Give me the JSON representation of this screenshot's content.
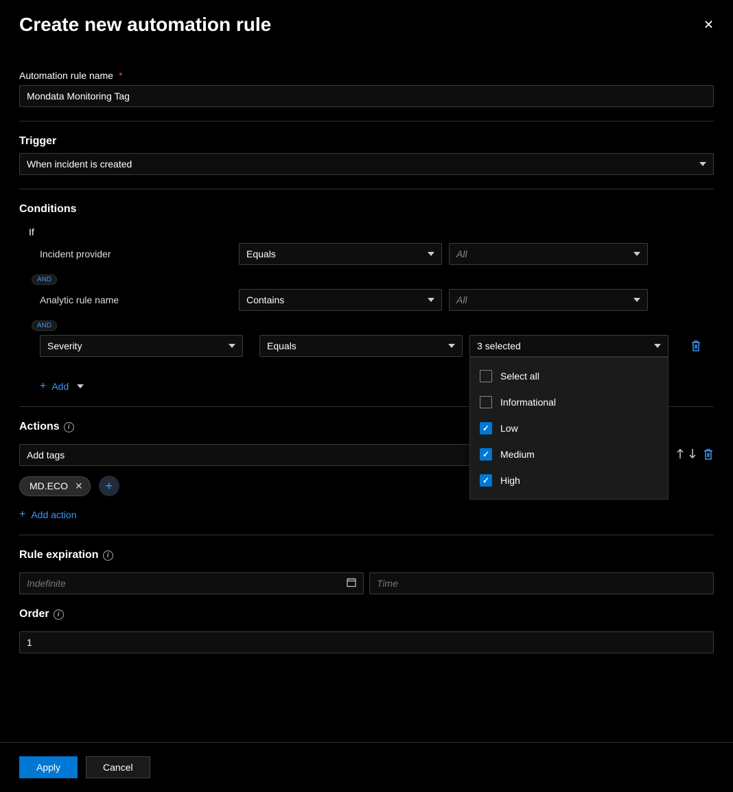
{
  "header": {
    "title": "Create new automation rule"
  },
  "ruleName": {
    "label": "Automation rule name",
    "value": "Mondata Monitoring Tag"
  },
  "trigger": {
    "label": "Trigger",
    "value": "When incident is created"
  },
  "conditions": {
    "title": "Conditions",
    "if": "If",
    "rows": [
      {
        "property": "Incident provider",
        "operator": "Equals",
        "value": "All",
        "fixed": true
      },
      {
        "property": "Analytic rule name",
        "operator": "Contains",
        "value": "All",
        "fixed": true
      },
      {
        "property": "Severity",
        "operator": "Equals",
        "value": "3 selected",
        "fixed": false
      }
    ],
    "and": "AND",
    "addLabel": "Add",
    "severityOptions": [
      {
        "label": "Select all",
        "checked": false
      },
      {
        "label": "Informational",
        "checked": false
      },
      {
        "label": "Low",
        "checked": true
      },
      {
        "label": "Medium",
        "checked": true
      },
      {
        "label": "High",
        "checked": true
      }
    ]
  },
  "actions": {
    "title": "Actions",
    "actionType": "Add tags",
    "tags": [
      "MD.ECO"
    ],
    "addActionLabel": "Add action"
  },
  "expiration": {
    "title": "Rule expiration",
    "datePlaceholder": "Indefinite",
    "timePlaceholder": "Time"
  },
  "order": {
    "title": "Order",
    "value": "1"
  },
  "footer": {
    "apply": "Apply",
    "cancel": "Cancel"
  }
}
